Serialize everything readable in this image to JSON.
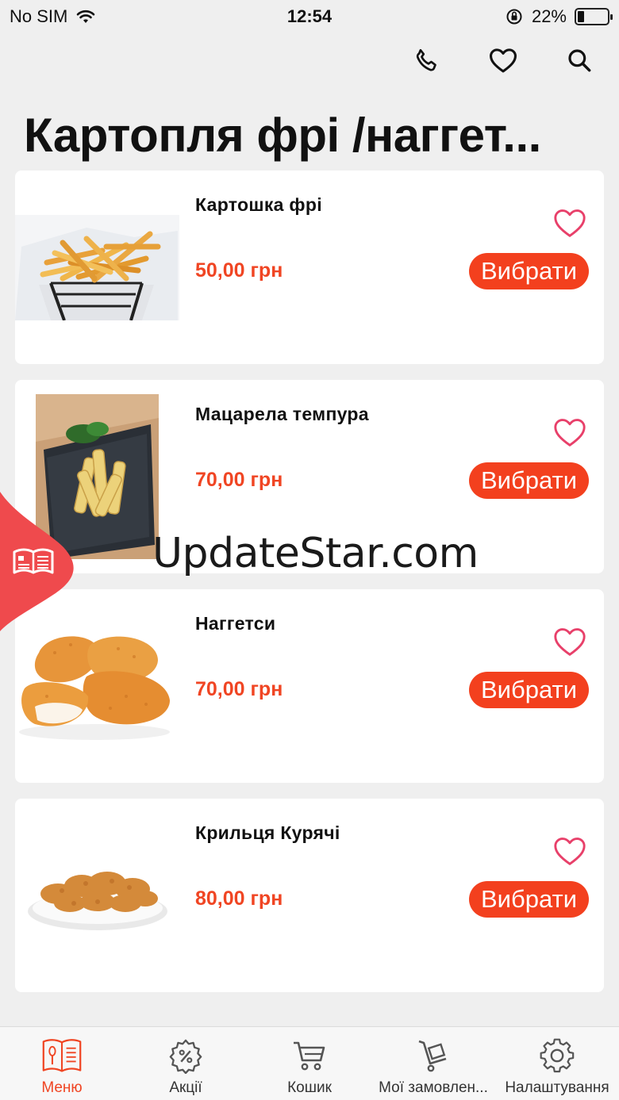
{
  "status": {
    "carrier": "No SIM",
    "time": "12:54",
    "battery": "22%",
    "battery_level": 0.22
  },
  "header": {
    "actions": [
      {
        "icon": "phone-icon"
      },
      {
        "icon": "heart-icon"
      },
      {
        "icon": "search-icon"
      }
    ],
    "title": "Картопля фрі /наггет..."
  },
  "products": [
    {
      "name": "Картошка фрі",
      "price": "50,00 грн",
      "button": "Вибрати",
      "image": "french-fries"
    },
    {
      "name": "Мацарела темпура",
      "price": "70,00 грн",
      "button": "Вибрати",
      "image": "mozzarella-sticks"
    },
    {
      "name": "Наггетси",
      "price": "70,00 грн",
      "button": "Вибрати",
      "image": "chicken-nuggets"
    },
    {
      "name": "Крильця Курячі",
      "price": "80,00 грн",
      "button": "Вибрати",
      "image": "chicken-wings"
    }
  ],
  "watermark": "UpdateStar.com",
  "tabs": [
    {
      "label": "Меню",
      "icon": "menu-book-icon",
      "active": true
    },
    {
      "label": "Акції",
      "icon": "discount-gear-icon",
      "active": false
    },
    {
      "label": "Кошик",
      "icon": "cart-icon",
      "active": false
    },
    {
      "label": "Мої замовлен...",
      "icon": "orders-cart-icon",
      "active": false
    },
    {
      "label": "Налаштування",
      "icon": "settings-icon",
      "active": false
    }
  ],
  "colors": {
    "accent": "#f3401e",
    "price": "#f04523",
    "favorite": "#e8406a",
    "background": "#efefef"
  }
}
